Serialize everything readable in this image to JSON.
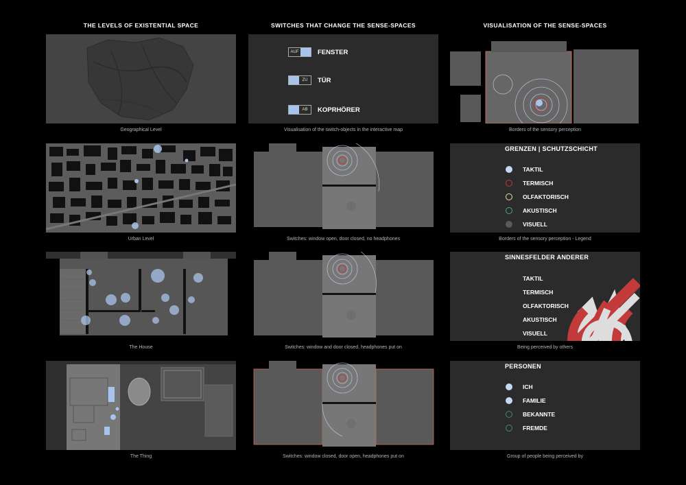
{
  "columns": [
    {
      "title": "THE LEVELS OF EXISTENTIAL SPACE"
    },
    {
      "title": "SWITCHES THAT CHANGE THE SENSE-SPACES"
    },
    {
      "title": "VISUALISATION OF THE SENSE-SPACES"
    }
  ],
  "captions": {
    "c1": [
      "Geographical Level",
      "Urban Level",
      "The House",
      "The Thing"
    ],
    "c2": [
      "Visualisation of the switch-objects in the interactive map",
      "Switches: window open, door closed, no headphones",
      "Switches: window and door closed, headphones put on",
      "Switches: window closed, door open, headphones put on"
    ],
    "c3": [
      "Borders of the sensory perception",
      "Borders of the sensory perception  - Legend",
      "Being perceived by others",
      "Group of people being perceived by"
    ]
  },
  "switches": [
    {
      "state": "AUF",
      "label": "FENSTER"
    },
    {
      "state": "ZU",
      "label": "TÜR"
    },
    {
      "state": "AB",
      "label": "KOPRHÖRER"
    }
  ],
  "legend_borders": {
    "title": "GRENZEN | SCHUTZSCHICHT",
    "items": [
      {
        "label": "TAKTIL",
        "color": "#c5d8f4"
      },
      {
        "label": "TERMISCH",
        "color": "#c23a3a"
      },
      {
        "label": "OLFAKTORISCH",
        "color": "#e8e39a"
      },
      {
        "label": "AKUSTISCH",
        "color": "#4aa58a"
      },
      {
        "label": "VISUELL",
        "color": "#5a5a5a"
      }
    ]
  },
  "legend_others": {
    "title": "SINNESFELDER ANDERER",
    "items": [
      {
        "label": "TAKTIL",
        "icon": "hand-icon"
      },
      {
        "label": "TERMISCH",
        "icon": "heat-icon"
      },
      {
        "label": "OLFAKTORISCH",
        "icon": "nose-icon"
      },
      {
        "label": "AKUSTISCH",
        "icon": "ear-icon"
      },
      {
        "label": "VISUELL",
        "icon": "eye-icon"
      }
    ]
  },
  "legend_persons": {
    "title": "PERSONEN",
    "items": [
      {
        "label": "ICH",
        "color": "#c5d8f4"
      },
      {
        "label": "FAMILIE",
        "color": "#c5d8f4"
      },
      {
        "label": "BEKANNTE",
        "color": "#3b8f6e"
      },
      {
        "label": "FREMDE",
        "color": "#3b8f6e"
      }
    ]
  }
}
